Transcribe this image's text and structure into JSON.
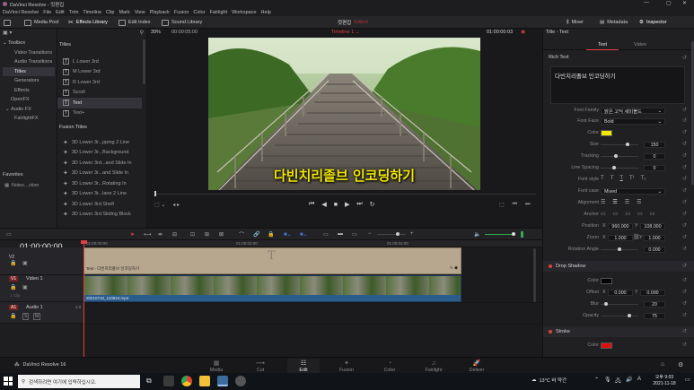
{
  "window": {
    "title": "DaVinci Resolve - 컷편집",
    "controls": [
      "—",
      "▢",
      "✕"
    ]
  },
  "menu": [
    "DaVinci Resolve",
    "File",
    "Edit",
    "Trim",
    "Timeline",
    "Clip",
    "Mark",
    "View",
    "Playback",
    "Fusion",
    "Color",
    "Fairlight",
    "Workspace",
    "Help"
  ],
  "toolbar": {
    "media_pool": "Media Pool",
    "effects_library": "Effects Library",
    "edit_index": "Edit Index",
    "sound_library": "Sound Library",
    "project_name": "컷편집",
    "project_status": "Edited",
    "mixer": "Mixer",
    "metadata": "Metadata",
    "inspector": "Inspector"
  },
  "viewer_bar": {
    "zoom": "39%",
    "source_tc": "00:00:05:00",
    "timeline_name": "Timeline 1",
    "timecode": "01:00:00:03"
  },
  "toolbox": {
    "items": [
      "Toolbox",
      "Video Transitions",
      "Audio Transitions",
      "Titles",
      "Generators",
      "Effects",
      "OpenFX",
      "Audio FX",
      "FairlightFX"
    ],
    "favorites": "Favorites",
    "fav_item": "Notes…ction"
  },
  "titles_panel": {
    "header": "Titles",
    "items": [
      {
        "glyph": "T",
        "label": "L Lower 3rd"
      },
      {
        "glyph": "T",
        "label": "M Lower 3rd"
      },
      {
        "glyph": "T",
        "label": "R Lower 3rd"
      },
      {
        "glyph": "T",
        "label": "Scroll"
      },
      {
        "glyph": "T",
        "label": "Text"
      },
      {
        "glyph": "T",
        "label": "Text+"
      }
    ],
    "fusion_header": "Fusion Titles",
    "fusion_items": [
      "3D Lower 3r...pping 2 Line",
      "3D Lower 3r...Background",
      "3D Lower 3rd...and Slide In",
      "3D Lower 3r...and Slide In",
      "3D Lower 3r...Rotating In",
      "3D Lower 3r...lane 2 Line",
      "3D Lower 3rd Shelf",
      "3D Lower 3rd Sliding Block"
    ]
  },
  "video_overlay_text": "다빈치리졸브 인코딩하기",
  "timeline": {
    "timecode": "01:00:00:00",
    "ruler": [
      "01:00:00:00",
      "01:00:02:00",
      "01:00:04:00"
    ],
    "tracks": [
      {
        "badge": "V2",
        "name": ""
      },
      {
        "badge": "V1",
        "name": "Video 1",
        "clips": "1 Clip"
      },
      {
        "badge": "A1",
        "name": "Audio 1",
        "level": "2.0"
      }
    ],
    "title_clip": "Text - 다빈치리졸브 인코딩하기",
    "video_clip": "20210710_110624.mp4"
  },
  "inspector": {
    "header": "Title - Text",
    "tabs": [
      "Text",
      "Video"
    ],
    "section_rich": "Rich Text",
    "text_value": "다빈치리졸브 인코딩하기",
    "font_family_label": "Font Family",
    "font_family": "맑은 고딕 세미볼드",
    "font_face_label": "Font Face",
    "font_face": "Bold",
    "color_label": "Color",
    "text_color": "#f2e800",
    "size_label": "Size",
    "size": "150",
    "tracking_label": "Tracking",
    "tracking": "0",
    "line_spacing_label": "Line Spacing",
    "line_spacing": "0",
    "font_style_label": "Font style",
    "font_style_glyphs": [
      "T",
      "T",
      "T",
      "T¹",
      "T₁"
    ],
    "font_case_label": "Font case",
    "font_case": "Mixed",
    "alignment_label": "Alignment",
    "anchor_label": "Anchor",
    "position_label": "Position",
    "position_x": "960.000",
    "position_y": "108.000",
    "zoom_label": "Zoom",
    "zoom_x": "1.000",
    "zoom_y": "1.000",
    "rotation_label": "Rotation Angle",
    "rotation": "0.000",
    "drop_shadow": "Drop Shadow",
    "ds_color_label": "Color",
    "ds_color": "#000000",
    "ds_offset_label": "Offset",
    "ds_offset_x": "0.000",
    "ds_offset_y": "0.000",
    "ds_blur_label": "Blur",
    "ds_blur": "20",
    "ds_opacity_label": "Opacity",
    "ds_opacity": "75",
    "stroke": "Stroke",
    "stroke_color_label": "Color",
    "stroke_color": "#e01010",
    "x_label": "X",
    "y_label": "Y"
  },
  "pages": [
    "Media",
    "Cut",
    "Edit",
    "Fusion",
    "Color",
    "Fairlight",
    "Deliver"
  ],
  "active_page": "Edit",
  "app_badge": "DaVinci Resolve 16",
  "taskbar": {
    "search": "검색하려면 여기에 입력하십시오.",
    "weather": "13°C 비 약간",
    "ime": "A",
    "time": "오후 9:03",
    "date": "2021-11-18"
  }
}
